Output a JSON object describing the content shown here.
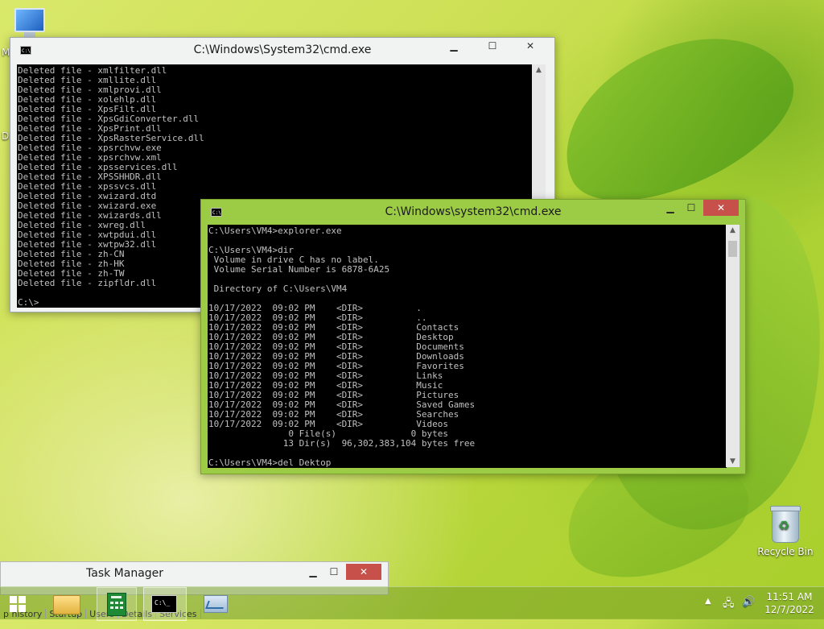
{
  "desktop": {
    "icons": [
      {
        "label": "Recycle Bin"
      }
    ],
    "fragments": [
      "M",
      "D"
    ]
  },
  "window_back": {
    "title": "C:\\Windows\\System32\\cmd.exe",
    "lines": [
      "Deleted file - xmlfilter.dll",
      "Deleted file - xmllite.dll",
      "Deleted file - xmlprovi.dll",
      "Deleted file - xolehlp.dll",
      "Deleted file - XpsFilt.dll",
      "Deleted file - XpsGdiConverter.dll",
      "Deleted file - XpsPrint.dll",
      "Deleted file - XpsRasterService.dll",
      "Deleted file - xpsrchvw.exe",
      "Deleted file - xpsrchvw.xml",
      "Deleted file - xpsservices.dll",
      "Deleted file - XPSSHHDR.dll",
      "Deleted file - xpssvcs.dll",
      "Deleted file - xwizard.dtd",
      "Deleted file - xwizard.exe",
      "Deleted file - xwizards.dll",
      "Deleted file - xwreg.dll",
      "Deleted file - xwtpdui.dll",
      "Deleted file - xwtpw32.dll",
      "Deleted file - zh-CN",
      "Deleted file - zh-HK",
      "Deleted file - zh-TW",
      "Deleted file - zipfldr.dll",
      "",
      "C:\\>"
    ]
  },
  "window_front": {
    "title": "C:\\Windows\\system32\\cmd.exe",
    "lines": [
      "C:\\Users\\VM4>explorer.exe",
      "",
      "C:\\Users\\VM4>dir",
      " Volume in drive C has no label.",
      " Volume Serial Number is 6878-6A25",
      "",
      " Directory of C:\\Users\\VM4",
      "",
      "10/17/2022  09:02 PM    <DIR>          .",
      "10/17/2022  09:02 PM    <DIR>          ..",
      "10/17/2022  09:02 PM    <DIR>          Contacts",
      "10/17/2022  09:02 PM    <DIR>          Desktop",
      "10/17/2022  09:02 PM    <DIR>          Documents",
      "10/17/2022  09:02 PM    <DIR>          Downloads",
      "10/17/2022  09:02 PM    <DIR>          Favorites",
      "10/17/2022  09:02 PM    <DIR>          Links",
      "10/17/2022  09:02 PM    <DIR>          Music",
      "10/17/2022  09:02 PM    <DIR>          Pictures",
      "10/17/2022  09:02 PM    <DIR>          Saved Games",
      "10/17/2022  09:02 PM    <DIR>          Searches",
      "10/17/2022  09:02 PM    <DIR>          Videos",
      "               0 File(s)              0 bytes",
      "              13 Dir(s)  96,302,383,104 bytes free",
      "",
      "C:\\Users\\VM4>del Dektop"
    ]
  },
  "task_manager": {
    "title": "Task Manager",
    "tabs": [
      "p history",
      "Startup",
      "Users",
      "Details",
      "Services"
    ]
  },
  "window_controls": {
    "minimize": "▁",
    "maximize": "☐",
    "close": "✕"
  },
  "scroll": {
    "up": "▲",
    "down": "▼"
  },
  "taskbar": {
    "cmd_label": "C:\\_",
    "tray": {
      "chevron": "▲",
      "network": "🖧",
      "volume": "🔊"
    },
    "clock": {
      "time": "11:51 AM",
      "date": "12/7/2022"
    }
  }
}
